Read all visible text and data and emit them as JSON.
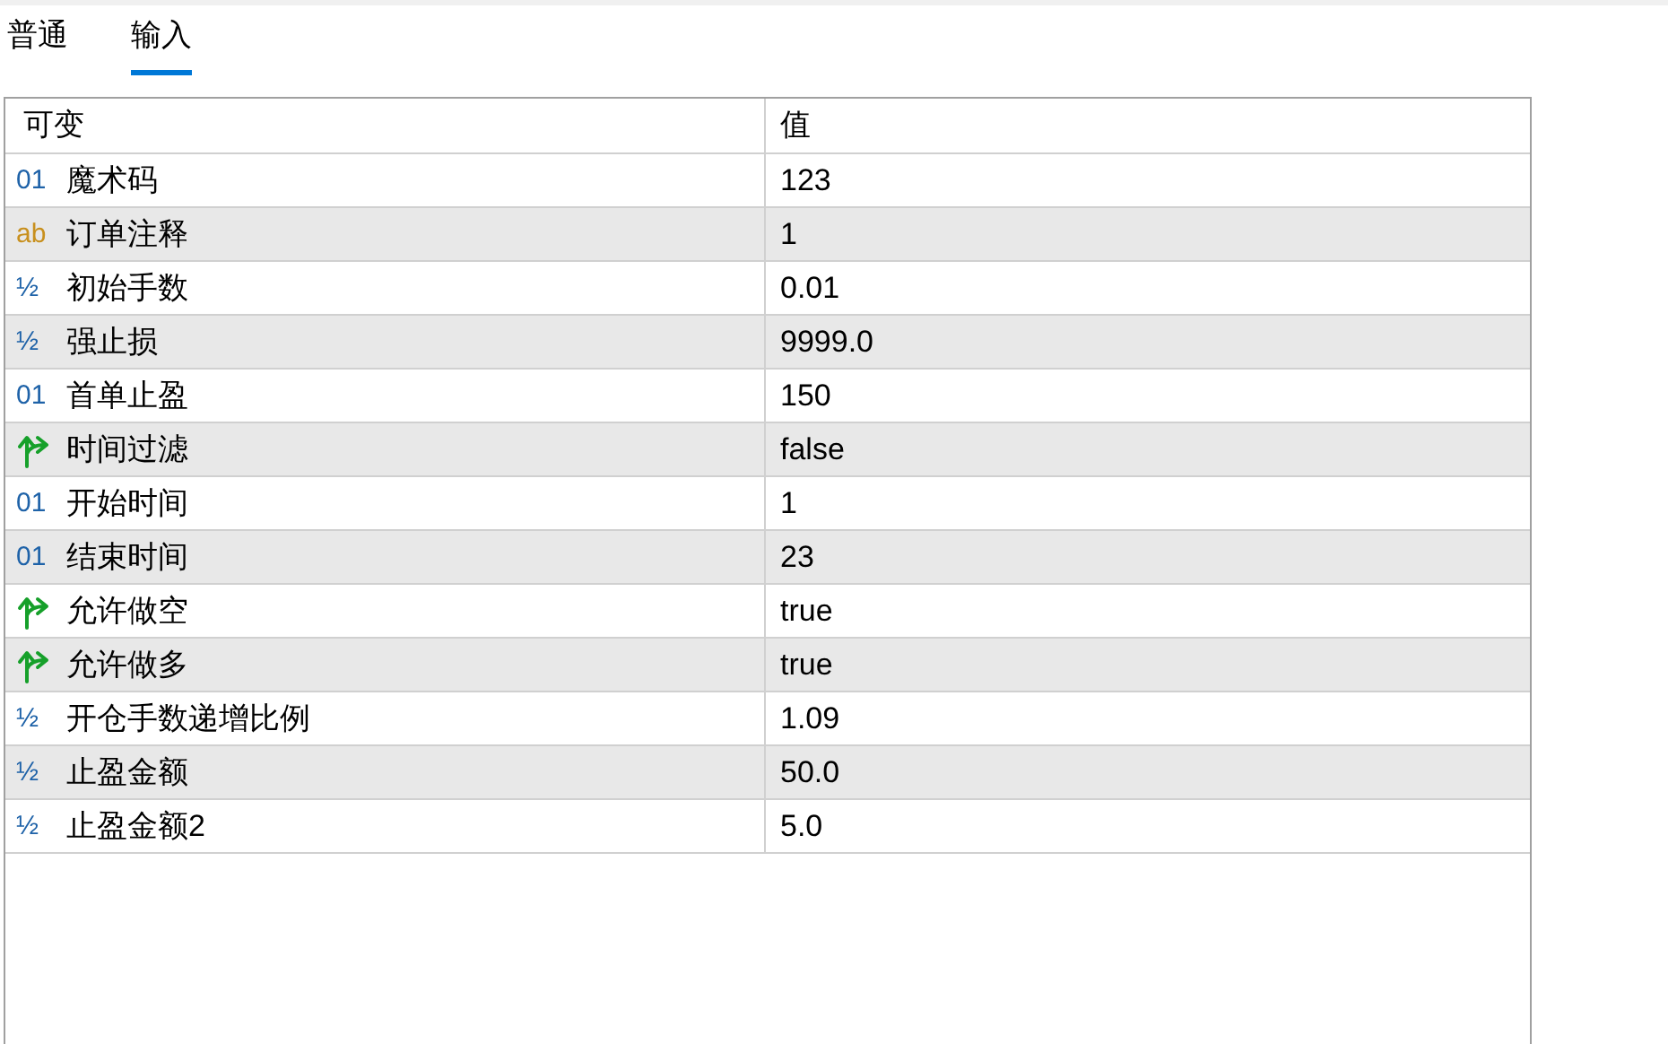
{
  "tabs": [
    {
      "label": "普通",
      "selected": false
    },
    {
      "label": "输入",
      "selected": true
    }
  ],
  "table": {
    "columns": [
      "可变",
      "值"
    ],
    "rows": [
      {
        "kind": "int",
        "icon": "01",
        "name": "魔术码",
        "value": "123"
      },
      {
        "kind": "string",
        "icon": "ab",
        "name": "订单注释",
        "value": "1"
      },
      {
        "kind": "double",
        "icon": "½",
        "name": "初始手数",
        "value": "0.01"
      },
      {
        "kind": "double",
        "icon": "½",
        "name": "强止损",
        "value": "9999.0"
      },
      {
        "kind": "int",
        "icon": "01",
        "name": "首单止盈",
        "value": "150"
      },
      {
        "kind": "bool",
        "name": "时间过滤",
        "value": "false"
      },
      {
        "kind": "int",
        "icon": "01",
        "name": "开始时间",
        "value": "1"
      },
      {
        "kind": "int",
        "icon": "01",
        "name": "结束时间",
        "value": "23"
      },
      {
        "kind": "bool",
        "name": "允许做空",
        "value": "true"
      },
      {
        "kind": "bool",
        "name": "允许做多",
        "value": "true"
      },
      {
        "kind": "double",
        "icon": "½",
        "name": "开仓手数递增比例",
        "value": "1.09"
      },
      {
        "kind": "double",
        "icon": "½",
        "name": "止盈金额",
        "value": "50.0"
      },
      {
        "kind": "double",
        "icon": "½",
        "name": "止盈金额2",
        "value": "5.0"
      }
    ]
  }
}
